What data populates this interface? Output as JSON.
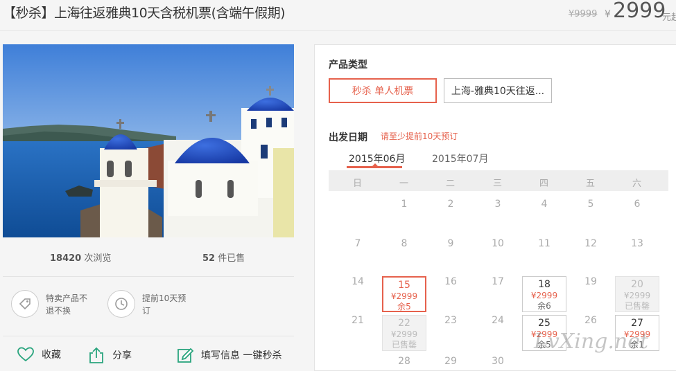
{
  "product": {
    "title": "【秒杀】上海往返雅典10天含税机票(含端午假期)",
    "original_price": "¥9999",
    "currency": "¥",
    "price": "2999",
    "price_unit": "元起"
  },
  "stats": {
    "views_count": "18420",
    "views_label": "次浏览",
    "sold_count": "52",
    "sold_label": "件已售"
  },
  "features": [
    {
      "icon": "tag-icon",
      "text": "特卖产品不退不换"
    },
    {
      "icon": "clock-icon",
      "text": "提前10天预订"
    }
  ],
  "actions": {
    "favorite": "收藏",
    "share": "分享",
    "fill_info": "填写信息 一键秒杀"
  },
  "product_type": {
    "label": "产品类型",
    "options": [
      {
        "text": "秒杀 单人机票",
        "selected": true
      },
      {
        "text": "上海-雅典10天往返...",
        "selected": false
      }
    ]
  },
  "departure": {
    "label": "出发日期",
    "hint": "请至少提前10天预订",
    "months": [
      {
        "text": "2015年06月",
        "active": true
      },
      {
        "text": "2015年07月",
        "active": false
      }
    ],
    "weekdays": [
      "日",
      "一",
      "二",
      "三",
      "四",
      "五",
      "六"
    ],
    "rows": [
      [
        {
          "day": ""
        },
        {
          "day": "1"
        },
        {
          "day": "2"
        },
        {
          "day": "3"
        },
        {
          "day": "4"
        },
        {
          "day": "5"
        },
        {
          "day": "6"
        }
      ],
      [
        {
          "day": "7"
        },
        {
          "day": "8"
        },
        {
          "day": "9"
        },
        {
          "day": "10"
        },
        {
          "day": "11"
        },
        {
          "day": "12"
        },
        {
          "day": "13"
        }
      ],
      [
        {
          "day": "14"
        },
        {
          "day": "15",
          "price": "¥2999",
          "remain": "余5",
          "state": "selected"
        },
        {
          "day": "16"
        },
        {
          "day": "17"
        },
        {
          "day": "18",
          "price": "¥2999",
          "remain": "余6",
          "state": "avail"
        },
        {
          "day": "19"
        },
        {
          "day": "20",
          "price": "¥2999",
          "remain": "已售罄",
          "state": "sold"
        }
      ],
      [
        {
          "day": "21"
        },
        {
          "day": "22",
          "price": "¥2999",
          "remain": "已售罄",
          "state": "sold"
        },
        {
          "day": "23"
        },
        {
          "day": "24"
        },
        {
          "day": "25",
          "price": "¥2999",
          "remain": "余5",
          "state": "avail"
        },
        {
          "day": "26"
        },
        {
          "day": "27",
          "price": "¥2999",
          "remain": "余1",
          "state": "avail"
        }
      ],
      [
        {
          "day": ""
        },
        {
          "day": "28"
        },
        {
          "day": "29"
        },
        {
          "day": "30"
        },
        {
          "day": ""
        },
        {
          "day": ""
        },
        {
          "day": ""
        }
      ]
    ]
  },
  "watermark": "LvXing.net",
  "colors": {
    "accent": "#e6614c",
    "sea": "#1c66b8",
    "dome": "#1f4fbf"
  }
}
